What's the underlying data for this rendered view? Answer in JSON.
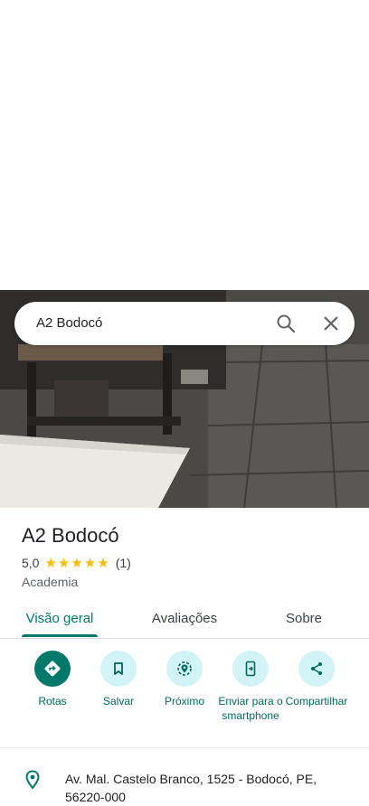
{
  "search": {
    "query": "A2 Bodocó"
  },
  "place": {
    "name": "A2 Bodocó",
    "rating": "5,0",
    "stars": 5,
    "review_count": "(1)",
    "category": "Academia"
  },
  "tabs": [
    {
      "label": "Visão geral",
      "active": true
    },
    {
      "label": "Avaliações",
      "active": false
    },
    {
      "label": "Sobre",
      "active": false
    }
  ],
  "actions": [
    {
      "label": "Rotas",
      "icon": "directions-icon"
    },
    {
      "label": "Salvar",
      "icon": "bookmark-icon"
    },
    {
      "label": "Próximo",
      "icon": "nearby-icon"
    },
    {
      "label": "Enviar para o smartphone",
      "icon": "send-to-phone-icon"
    },
    {
      "label": "Compartilhar",
      "icon": "share-icon"
    }
  ],
  "address": {
    "text": "Av. Mal. Castelo Branco, 1525 - Bodocó, PE, 56220-000"
  },
  "colors": {
    "accent": "#00796b",
    "chip": "#d3f4f7",
    "star": "#fbbc04"
  }
}
